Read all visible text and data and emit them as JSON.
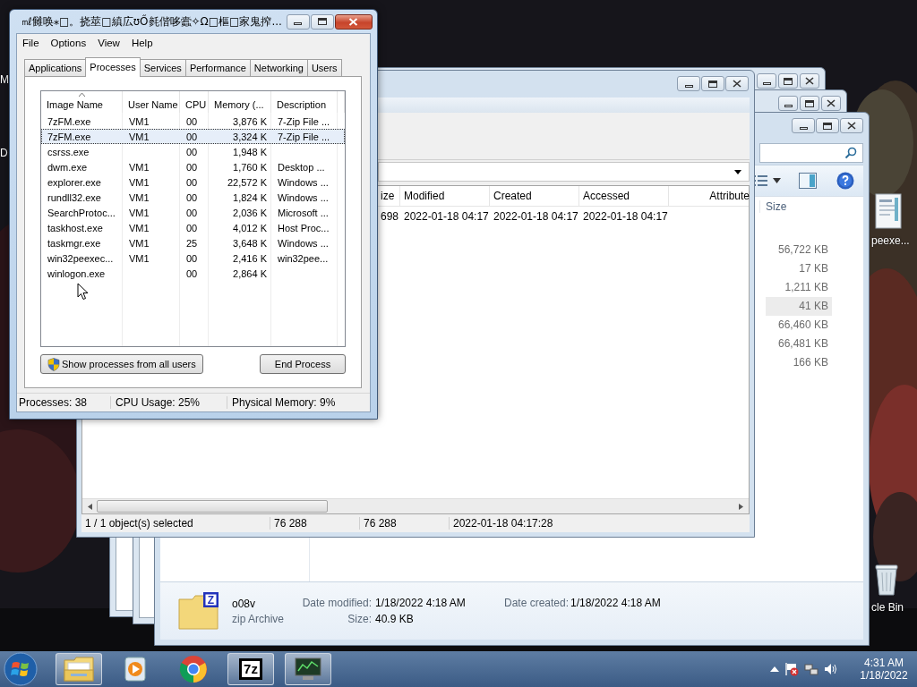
{
  "desktop": {
    "edge_labels": [
      "M",
      "D"
    ],
    "icons": [
      {
        "kind": "document",
        "label": "peexe..."
      },
      {
        "kind": "recycle-bin",
        "label": "cle Bin"
      }
    ]
  },
  "explorer": {
    "size_column": "Size",
    "sizes": [
      {
        "value": "56,722 KB",
        "selected": false
      },
      {
        "value": "17 KB",
        "selected": false
      },
      {
        "value": "1,211 KB",
        "selected": false
      },
      {
        "value": "41 KB",
        "selected": true
      },
      {
        "value": "66,460 KB",
        "selected": false
      },
      {
        "value": "66,481 KB",
        "selected": false
      },
      {
        "value": "166 KB",
        "selected": false
      }
    ],
    "details": {
      "name": "o08v",
      "type": "zip Archive",
      "icon_letter": "Z",
      "fields": [
        {
          "label": "Date modified:",
          "value": "1/18/2022 4:18 AM"
        },
        {
          "label": "Size:",
          "value": "40.9 KB"
        },
        {
          "label": "Date created:",
          "value": "1/18/2022 4:18 AM"
        }
      ]
    }
  },
  "sevenzip": {
    "columns": [
      "ize",
      "Modified",
      "Created",
      "Accessed",
      "Attribute"
    ],
    "rows": [
      [
        "698",
        "2022-01-18 04:17",
        "2022-01-18 04:17",
        "2022-01-18 04:17"
      ]
    ],
    "status_bar": [
      "1 / 1 object(s) selected",
      "76 288",
      "76 288",
      "2022-01-18 04:17:28"
    ]
  },
  "task_manager": {
    "title": "㎖雠唤⁎□。挠莁□縝広ʊŐ毵偕哆蠹✧Ω□樞□家鬼搾...",
    "menu": [
      "File",
      "Options",
      "View",
      "Help"
    ],
    "tabs": [
      {
        "label": "Applications",
        "selected": false
      },
      {
        "label": "Processes",
        "selected": true
      },
      {
        "label": "Services",
        "selected": false
      },
      {
        "label": "Performance",
        "selected": false
      },
      {
        "label": "Networking",
        "selected": false
      },
      {
        "label": "Users",
        "selected": false
      }
    ],
    "columns": [
      {
        "label": "Image Name",
        "sorted": true
      },
      {
        "label": "User Name",
        "sorted": false
      },
      {
        "label": "CPU",
        "sorted": false
      },
      {
        "label": "Memory (...",
        "sorted": false
      },
      {
        "label": "Description",
        "sorted": false
      }
    ],
    "processes": [
      {
        "image": "7zFM.exe",
        "user": "VM1",
        "cpu": "00",
        "memory": "3,876 K",
        "description": "7-Zip File ...",
        "selected": false
      },
      {
        "image": "7zFM.exe",
        "user": "VM1",
        "cpu": "00",
        "memory": "3,324 K",
        "description": "7-Zip File ...",
        "selected": true
      },
      {
        "image": "csrss.exe",
        "cpu": "00",
        "memory": "1,948 K",
        "selected": false
      },
      {
        "image": "dwm.exe",
        "user": "VM1",
        "cpu": "00",
        "memory": "1,760 K",
        "description": "Desktop ...",
        "selected": false
      },
      {
        "image": "explorer.exe",
        "user": "VM1",
        "cpu": "00",
        "memory": "22,572 K",
        "description": "Windows ...",
        "selected": false
      },
      {
        "image": "rundll32.exe",
        "user": "VM1",
        "cpu": "00",
        "memory": "1,824 K",
        "description": "Windows ...",
        "selected": false
      },
      {
        "image": "SearchProtoc...",
        "user": "VM1",
        "cpu": "00",
        "memory": "2,036 K",
        "description": "Microsoft ...",
        "selected": false
      },
      {
        "image": "taskhost.exe",
        "user": "VM1",
        "cpu": "00",
        "memory": "4,012 K",
        "description": "Host Proc...",
        "selected": false
      },
      {
        "image": "taskmgr.exe",
        "user": "VM1",
        "cpu": "25",
        "memory": "3,648 K",
        "description": "Windows ...",
        "selected": false
      },
      {
        "image": "win32peexec...",
        "user": "VM1",
        "cpu": "00",
        "memory": "2,416 K",
        "description": "win32pee...",
        "selected": false
      },
      {
        "image": "winlogon.exe",
        "cpu": "00",
        "memory": "2,864 K",
        "selected": false
      }
    ],
    "buttons": [
      {
        "label": "Show processes from all users",
        "kind": "shield"
      },
      {
        "label": "End Process",
        "kind": "plain"
      }
    ],
    "status_bar": [
      "Processes: 38",
      "CPU Usage: 25%",
      "Physical Memory: 9%"
    ]
  },
  "taskbar": {
    "items": [
      {
        "kind": "folder",
        "active": true
      },
      {
        "kind": "media",
        "active": false
      },
      {
        "kind": "browser",
        "active": false
      },
      {
        "kind": "archiver",
        "label": "7z",
        "active": true
      },
      {
        "kind": "monitor",
        "active": true
      }
    ],
    "clock": {
      "time": "4:31 AM",
      "date": "1/18/2022"
    }
  }
}
